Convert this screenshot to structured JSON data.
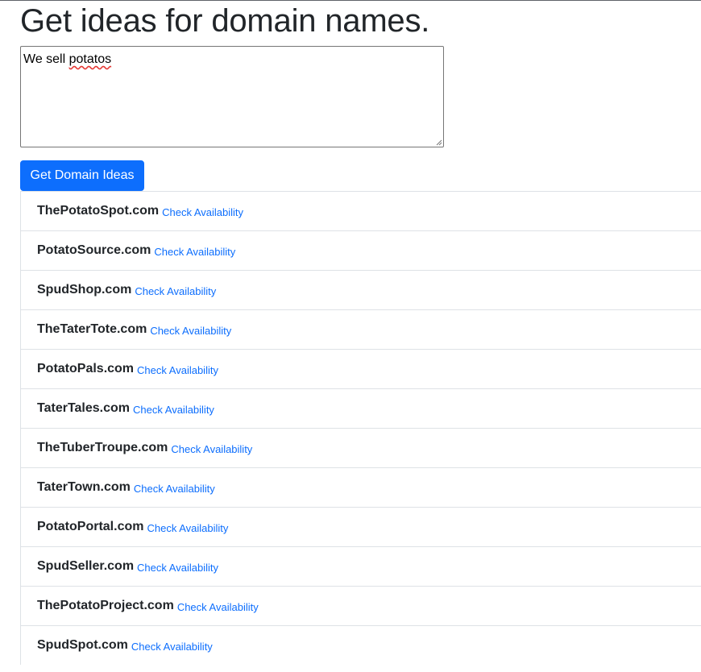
{
  "header": {
    "title": "Get ideas for domain names."
  },
  "form": {
    "description_before": "We sell ",
    "description_typo": "potatos",
    "submit_label": "Get Domain Ideas"
  },
  "ideas": [
    {
      "domain": "ThePotatoSpot.com",
      "link": "Check Availability"
    },
    {
      "domain": "PotatoSource.com",
      "link": "Check Availability"
    },
    {
      "domain": "SpudShop.com",
      "link": "Check Availability"
    },
    {
      "domain": "TheTaterTote.com",
      "link": "Check Availability"
    },
    {
      "domain": "PotatoPals.com",
      "link": "Check Availability"
    },
    {
      "domain": "TaterTales.com",
      "link": "Check Availability"
    },
    {
      "domain": "TheTuberTroupe.com",
      "link": "Check Availability"
    },
    {
      "domain": "TaterTown.com",
      "link": "Check Availability"
    },
    {
      "domain": "PotatoPortal.com",
      "link": "Check Availability"
    },
    {
      "domain": "SpudSeller.com",
      "link": "Check Availability"
    },
    {
      "domain": "ThePotatoProject.com",
      "link": "Check Availability"
    },
    {
      "domain": "SpudSpot.com",
      "link": "Check Availability"
    }
  ],
  "colors": {
    "primary": "#0d6efd",
    "text": "#212529",
    "border": "#dee2e6"
  }
}
